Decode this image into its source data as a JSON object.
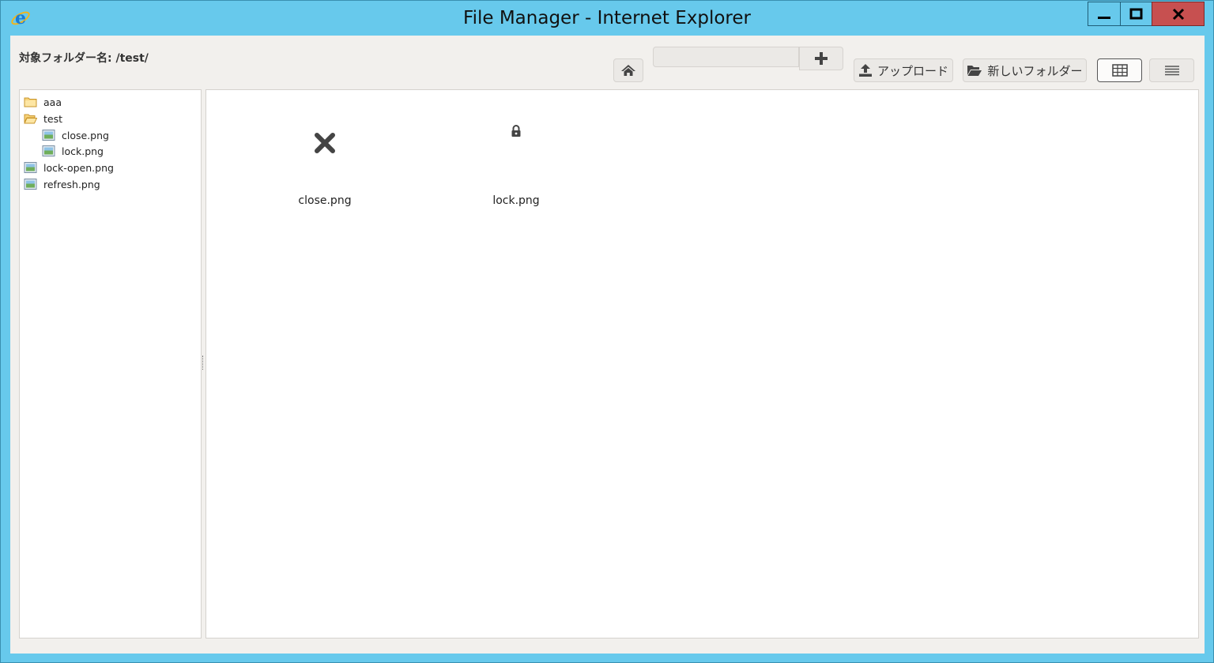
{
  "window": {
    "title": "File Manager - Internet Explorer",
    "controls": [
      "minimize",
      "maximize",
      "close"
    ],
    "colors": {
      "titlebar": "#67c9ec",
      "close_button": "#c75050"
    }
  },
  "header": {
    "folder_label": "対象フォルダー名: /test/"
  },
  "toolbar": {
    "home_icon": "home-icon",
    "new_name_value": "",
    "add_icon": "plus-icon",
    "upload_label": "アップロード",
    "upload_icon": "upload-icon",
    "new_folder_label": "新しいフォルダー",
    "new_folder_icon": "folder-open-icon",
    "grid_view_icon": "grid-view-icon",
    "list_view_icon": "list-view-icon",
    "active_view": "grid"
  },
  "tree": {
    "items": [
      {
        "label": "aaa",
        "type": "folder",
        "depth": 0
      },
      {
        "label": "test",
        "type": "folder-open",
        "depth": 0
      },
      {
        "label": "close.png",
        "type": "image",
        "depth": 1
      },
      {
        "label": "lock.png",
        "type": "image",
        "depth": 1
      },
      {
        "label": "lock-open.png",
        "type": "image",
        "depth": 0
      },
      {
        "label": "refresh.png",
        "type": "image",
        "depth": 0
      }
    ]
  },
  "files": {
    "items": [
      {
        "name": "close.png",
        "icon": "close-icon"
      },
      {
        "name": "lock.png",
        "icon": "lock-icon"
      }
    ]
  }
}
